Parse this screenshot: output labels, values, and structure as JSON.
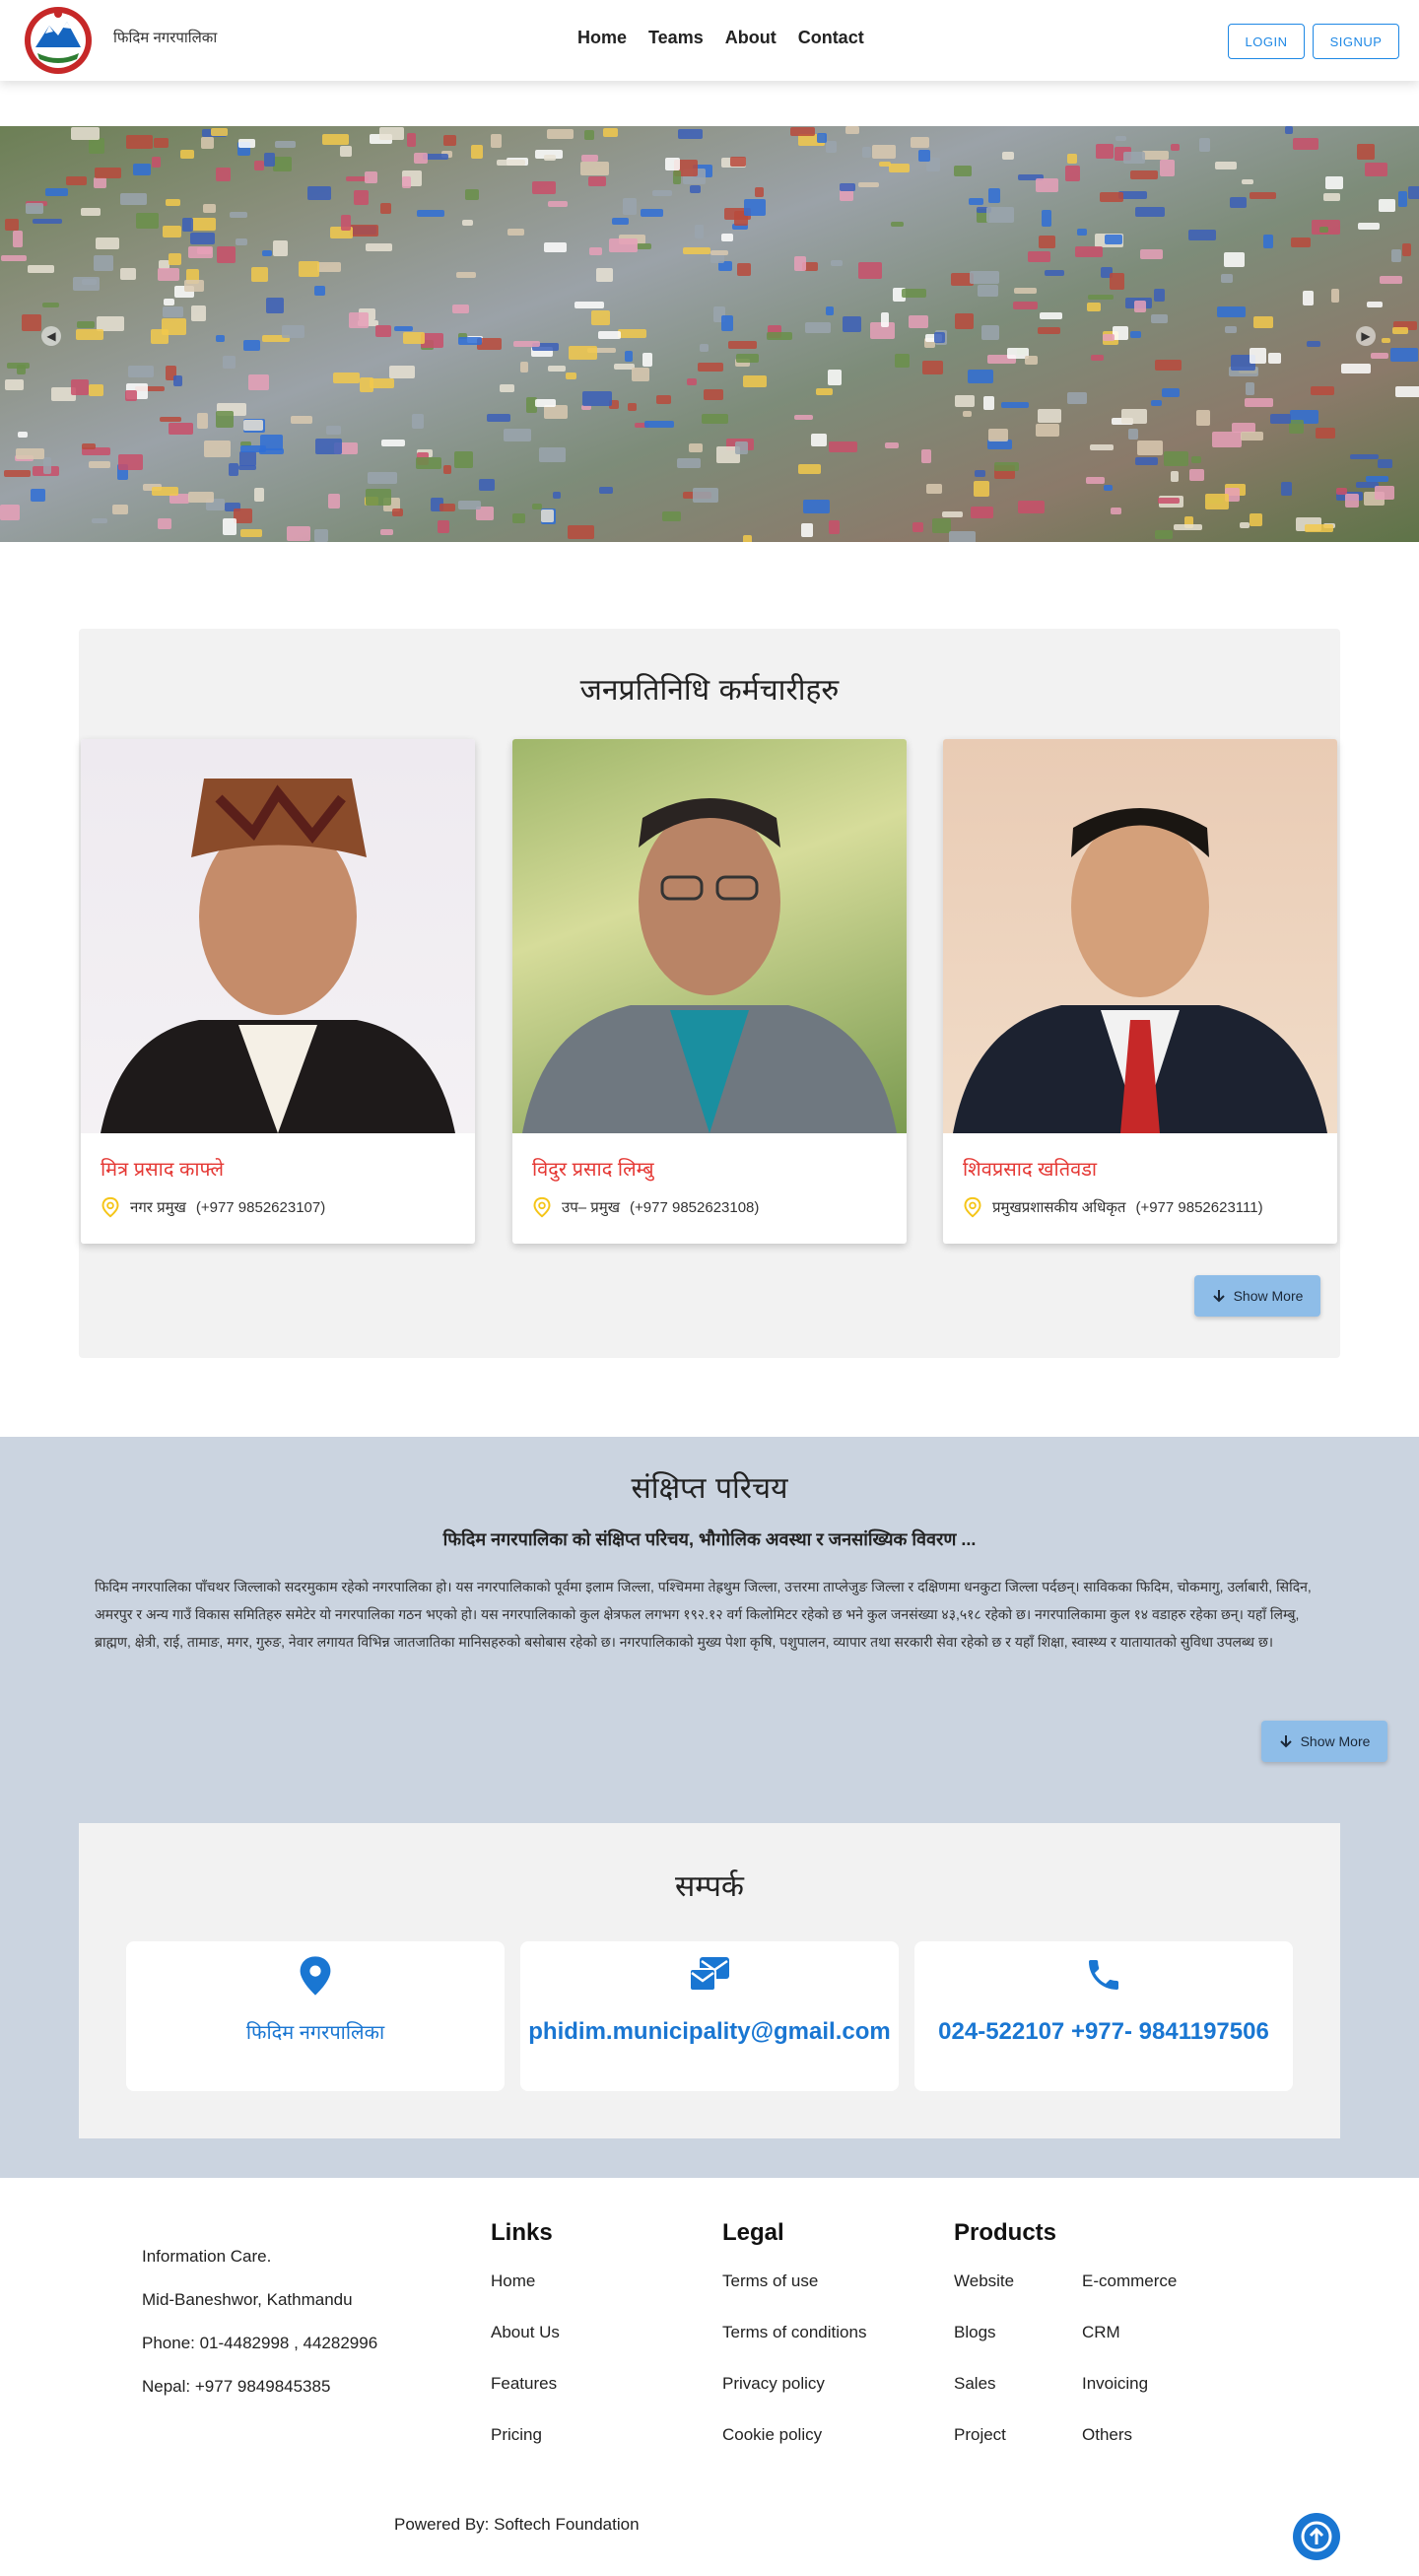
{
  "header": {
    "site_name": "फिदिम नगरपालिका",
    "nav": [
      "Home",
      "Teams",
      "About",
      "Contact"
    ],
    "login_label": "LOGIN",
    "signup_label": "SIGNUP"
  },
  "representatives": {
    "title": "जनप्रतिनिधि कर्मचारीहरु",
    "members": [
      {
        "name": "मित्र प्रसाद काफ्ले",
        "position": "नगर प्रमुख",
        "phone": "(+977 9852623107)"
      },
      {
        "name": "विदुर प्रसाद लिम्बु",
        "position": "उप– प्रमुख",
        "phone": "(+977 9852623108)"
      },
      {
        "name": "शिवप्रसाद खतिवडा",
        "position": "प्रमुखप्रशासकीय अधिकृत",
        "phone": "(+977 9852623111)"
      }
    ],
    "show_more_label": "Show More"
  },
  "intro": {
    "title": "संक्षिप्त परिचय",
    "subtitle": "फिदिम नगरपालिका को संक्षिप्त परिचय, भौगोलिक अवस्था र जनसांख्यिक विवरण ...",
    "body": "फिदिम नगरपालिका पाँचथर जिल्लाको सदरमुकाम रहेको नगरपालिका हो। यस नगरपालिकाको पूर्वमा इलाम जिल्ला, पश्चिममा तेह्रथुम जिल्ला, उत्तरमा ताप्लेजुङ जिल्ला र दक्षिणमा धनकुटा जिल्ला पर्दछन्। साविकका फिदिम, चोकमागु, उर्लाबारी, सिदिन, अमरपुर र अन्य गाउँ विकास समितिहरु समेटेर यो नगरपालिका गठन भएको हो। यस नगरपालिकाको कुल क्षेत्रफल लगभग १९२.१२ वर्ग किलोमिटर रहेको छ भने कुल जनसंख्या ४३,५१८ रहेको छ। नगरपालिकामा कुल १४ वडाहरु रहेका छन्। यहाँ लिम्बु, ब्राह्मण, क्षेत्री, राई, तामाङ, मगर, गुरुङ, नेवार लगायत विभिन्न जातजातिका मानिसहरुको बसोबास रहेको छ। नगरपालिकाको मुख्य पेशा कृषि, पशुपालन, व्यापार तथा सरकारी सेवा रहेको छ र यहाँ शिक्षा, स्वास्थ्य र यातायातको सुविधा उपलब्ध छ।",
    "show_more_label": "Show More"
  },
  "contact": {
    "title": "सम्पर्क",
    "address": "फिदिम नगरपालिका",
    "email": "phidim.municipality@gmail.com",
    "phone": "024-522107 +977- 9841197506"
  },
  "footer": {
    "info": [
      "Information Care.",
      "Mid-Baneshwor, Kathmandu",
      "Phone: 01-4482998 , 44282996",
      "Nepal: +977 9849845385"
    ],
    "links": {
      "title": "Links",
      "items": [
        "Home",
        "About Us",
        "Features",
        "Pricing"
      ]
    },
    "legal": {
      "title": "Legal",
      "items": [
        "Terms of use",
        "Terms of conditions",
        "Privacy policy",
        "Cookie policy"
      ]
    },
    "products": {
      "title": "Products",
      "col1": [
        "Website",
        "Blogs",
        "Sales",
        "Project"
      ],
      "col2": [
        "E-commerce",
        "CRM",
        "Invoicing",
        "Others"
      ]
    },
    "powered_by": "Powered By: Softech Foundation"
  },
  "colors": {
    "accent": "#1976d2",
    "name_red": "#e53935",
    "pin_yellow": "#f5c518",
    "intro_bg": "#cbd4e0"
  }
}
